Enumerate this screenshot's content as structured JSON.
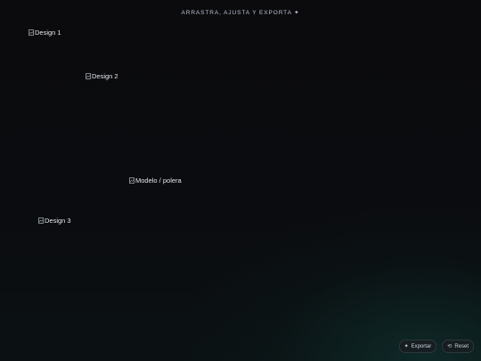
{
  "header": {
    "banner_text": "ARRASTRA, AJUSTA Y EXPORTA ✦"
  },
  "canvas": {
    "items": [
      {
        "alt": "Design 1",
        "icon": "broken-image-icon"
      },
      {
        "alt": "Design 2",
        "icon": "broken-image-icon"
      },
      {
        "alt": "Modelo / polera",
        "icon": "broken-image-icon"
      },
      {
        "alt": "Design 3",
        "icon": "broken-image-icon"
      }
    ]
  },
  "toolbar": {
    "export_icon": "✦",
    "export_label": "Exportar",
    "reset_icon": "⟲",
    "reset_label": "Reset"
  },
  "colors": {
    "background": "#0b0b0e",
    "glow": "#123e3a",
    "text": "#d9dde2"
  }
}
